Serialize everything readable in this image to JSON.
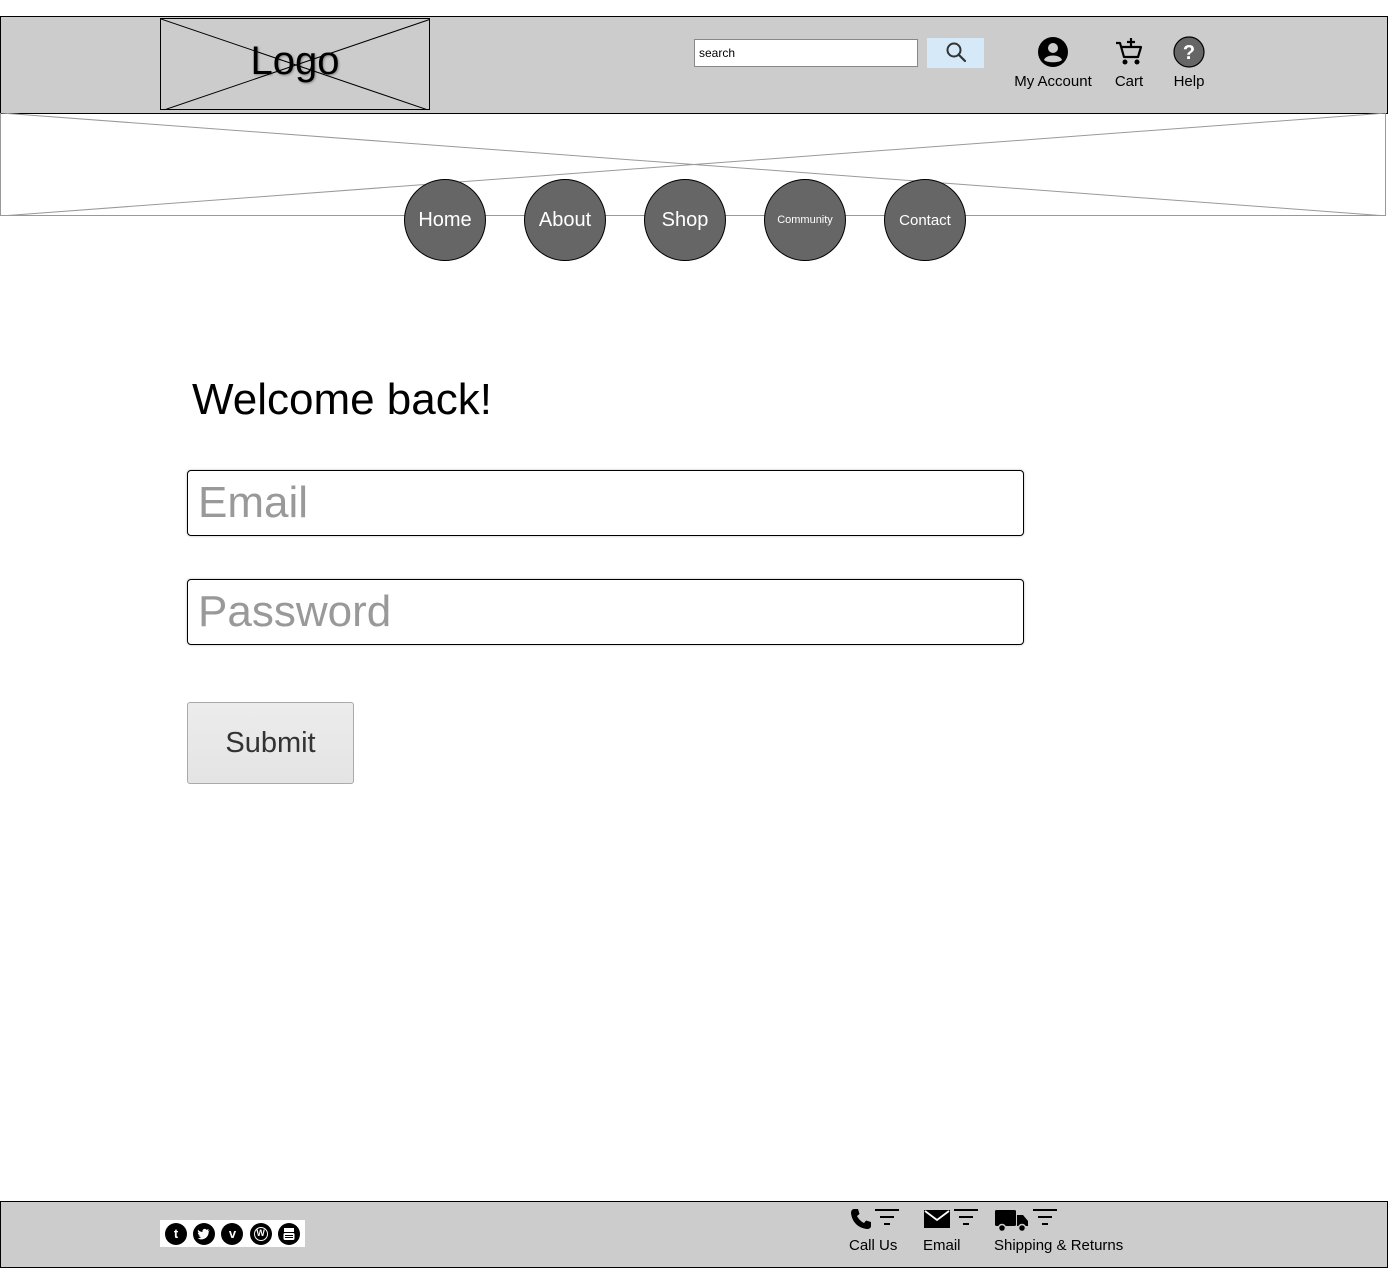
{
  "header": {
    "logo_text": "Logo",
    "search": {
      "placeholder": "search",
      "value": "search"
    },
    "search_button_icon": "search-icon",
    "links": [
      {
        "label": "My Account",
        "icon": "account-circle-icon"
      },
      {
        "label": "Cart",
        "icon": "cart-add-icon"
      },
      {
        "label": "Help",
        "icon": "question-circle-icon"
      }
    ]
  },
  "nav": {
    "items": [
      {
        "label": "Home"
      },
      {
        "label": "About"
      },
      {
        "label": "Shop"
      },
      {
        "label": "Community"
      },
      {
        "label": "Contact"
      }
    ]
  },
  "main": {
    "title": "Welcome back!",
    "email_placeholder": "Email",
    "password_placeholder": "Password",
    "submit_label": "Submit"
  },
  "footer": {
    "social": [
      {
        "icon": "tumblr-icon",
        "glyph": "t"
      },
      {
        "icon": "twitter-icon",
        "glyph": ""
      },
      {
        "icon": "vimeo-icon",
        "glyph": "v"
      },
      {
        "icon": "wordpress-icon",
        "glyph": "W"
      },
      {
        "icon": "youtube-icon",
        "glyph": ""
      }
    ],
    "links": [
      {
        "label": "Call Us",
        "icon": "phone-icon"
      },
      {
        "label": "Email",
        "icon": "envelope-icon"
      },
      {
        "label": "Shipping & Returns",
        "icon": "truck-icon"
      }
    ]
  },
  "colors": {
    "header_bg": "#cccccc",
    "nav_circle": "#666666",
    "search_button": "#d5e9f8",
    "placeholder": "#999999"
  }
}
